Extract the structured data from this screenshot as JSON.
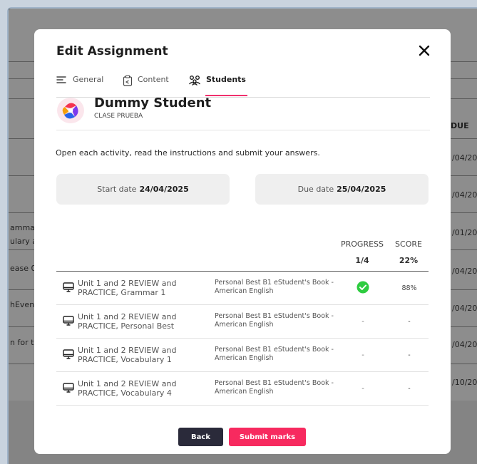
{
  "background": {
    "column_due": "DUE",
    "dates": [
      "/04/202",
      "/04/202",
      "/01/202",
      "/04/202",
      "/04/202",
      "/04/202",
      "/10/202"
    ],
    "left_snippets": [
      "amma",
      "ulary a",
      "ease 0",
      "hEvent",
      "n for te"
    ]
  },
  "modal": {
    "title": "Edit Assignment",
    "tabs": [
      {
        "label": "General",
        "icon": "lines-icon",
        "active": false
      },
      {
        "label": "Content",
        "icon": "clipboard-icon",
        "active": false
      },
      {
        "label": "Students",
        "icon": "users-icon",
        "active": true
      }
    ],
    "student": {
      "name": "Dummy Student",
      "class": "CLASE PRUEBA"
    },
    "instructions": "Open each activity, read the instructions and submit your answers.",
    "start_date": {
      "label": "Start date",
      "value": "24/04/2025"
    },
    "due_date": {
      "label": "Due date",
      "value": "25/04/2025"
    },
    "table": {
      "headers": {
        "progress": "PROGRESS",
        "score": "SCORE"
      },
      "totals": {
        "progress": "1/4",
        "score": "22%"
      },
      "rows": [
        {
          "name": "Unit 1 and 2 REVIEW and PRACTICE, Grammar 1",
          "book": "Personal Best B1 eStudent's Book - American English",
          "progress": "check",
          "score": "88%"
        },
        {
          "name": "Unit 1 and 2 REVIEW and PRACTICE, Personal Best",
          "book": "Personal Best B1 eStudent's Book - American English",
          "progress": "-",
          "score": "-"
        },
        {
          "name": "Unit 1 and 2 REVIEW and PRACTICE, Vocabulary 1",
          "book": "Personal Best B1 eStudent's Book - American English",
          "progress": "-",
          "score": "-"
        },
        {
          "name": "Unit 1 and 2 REVIEW and PRACTICE, Vocabulary 4",
          "book": "Personal Best B1 eStudent's Book - American English",
          "progress": "-",
          "score": "-"
        }
      ]
    },
    "buttons": {
      "back": "Back",
      "submit": "Submit marks"
    },
    "colors": {
      "accent": "#f72a5f",
      "dark": "#2a2a3a",
      "success": "#2ecc40"
    }
  }
}
